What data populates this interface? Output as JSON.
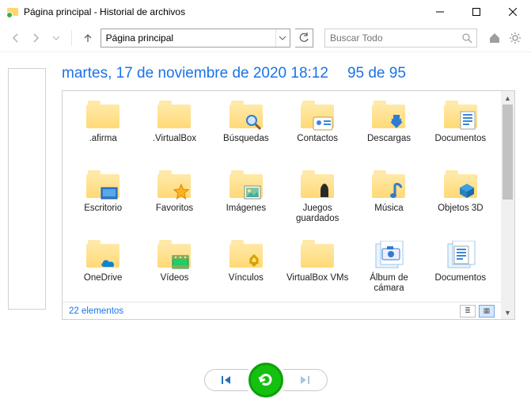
{
  "window": {
    "title": "Página principal - Historial de archivos"
  },
  "toolbar": {
    "address": "Página principal",
    "search_placeholder": "Buscar Todo"
  },
  "heading": {
    "date": "martes, 17 de noviembre de 2020 18:12",
    "counter": "95 de 95"
  },
  "items": [
    {
      "label": ".afirma",
      "type": "folder"
    },
    {
      "label": ".VirtualBox",
      "type": "folder"
    },
    {
      "label": "Búsquedas",
      "type": "folder",
      "overlay": "search"
    },
    {
      "label": "Contactos",
      "type": "folder",
      "overlay": "contact"
    },
    {
      "label": "Descargas",
      "type": "folder",
      "overlay": "download"
    },
    {
      "label": "Documentos",
      "type": "folder",
      "overlay": "doc"
    },
    {
      "label": "Escritorio",
      "type": "folder",
      "overlay": "desktop"
    },
    {
      "label": "Favoritos",
      "type": "folder",
      "overlay": "star"
    },
    {
      "label": "Imágenes",
      "type": "folder",
      "overlay": "image"
    },
    {
      "label": "Juegos guardados",
      "type": "folder",
      "overlay": "games"
    },
    {
      "label": "Música",
      "type": "folder",
      "overlay": "music"
    },
    {
      "label": "Objetos 3D",
      "type": "folder",
      "overlay": "cube"
    },
    {
      "label": "OneDrive",
      "type": "folder",
      "overlay": "cloud"
    },
    {
      "label": "Vídeos",
      "type": "folder",
      "overlay": "video"
    },
    {
      "label": "Vínculos",
      "type": "folder",
      "overlay": "link"
    },
    {
      "label": "VirtualBox VMs",
      "type": "folder"
    },
    {
      "label": "Álbum de cámara",
      "type": "library",
      "overlay": "camera"
    },
    {
      "label": "Documentos",
      "type": "library",
      "overlay": "doc"
    }
  ],
  "status": {
    "count_text": "22 elementos"
  }
}
